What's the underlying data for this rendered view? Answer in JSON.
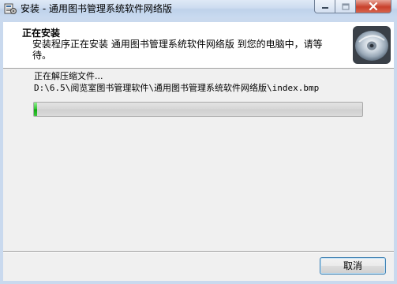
{
  "window": {
    "title": "安装 - 通用图书管理系统软件网络版",
    "title_icon": "setup-icon",
    "controls": [
      "minimize-icon",
      "maximize-icon",
      "close-icon"
    ]
  },
  "header": {
    "title": "正在安装",
    "description": "安装程序正在安装 通用图书管理系统软件网络版 到您的电脑中，请等待。",
    "image": "install-disc-icon"
  },
  "status": {
    "text": "正在解压缩文件...",
    "path": "D:\\6.5\\阅览室图书管理软件\\通用图书管理系统软件网络版\\index.bmp"
  },
  "progress": {
    "fraction": 0.01,
    "color": "#22b422"
  },
  "buttons": {
    "cancel": "取消"
  }
}
